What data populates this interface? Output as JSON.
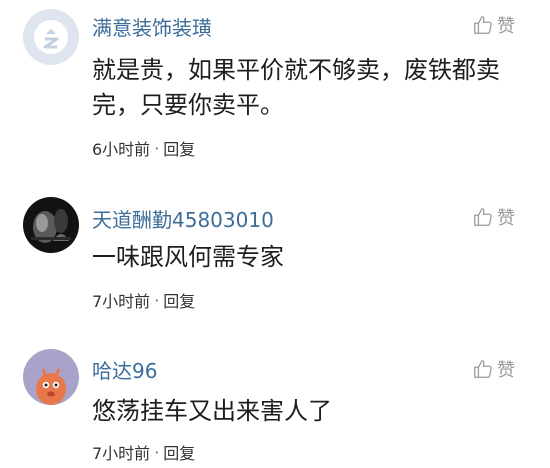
{
  "comments": [
    {
      "username": "满意装饰装璜",
      "avatar_icon": "default-avatar-icon",
      "like_label": "赞",
      "text": "就是贵，如果平价就不够卖，废铁都卖完，只要你卖平。",
      "time": "6小时前",
      "separator": "·",
      "reply_label": "回复"
    },
    {
      "username": "天道酬勤45803010",
      "avatar_icon": "dark-photo-avatar",
      "like_label": "赞",
      "text": "一味跟风何需专家",
      "time": "7小时前",
      "separator": "·",
      "reply_label": "回复"
    },
    {
      "username": "哈达96",
      "avatar_icon": "cartoon-avatar",
      "like_label": "赞",
      "text": "悠荡挂车又出来害人了",
      "time": "7小时前",
      "separator": "·",
      "reply_label": "回复"
    }
  ],
  "colors": {
    "username": "#3d6d99",
    "like": "#9a9a9a",
    "text": "#1e1e1e",
    "meta": "#333333"
  }
}
